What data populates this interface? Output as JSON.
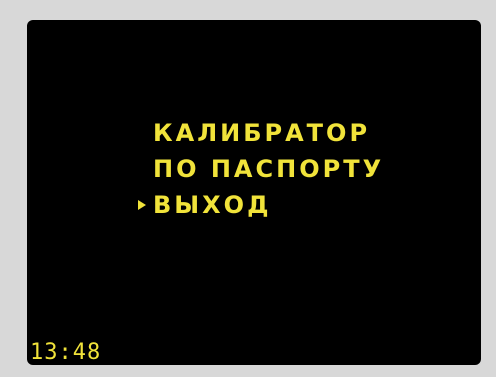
{
  "colors": {
    "text": "#f1e33a",
    "screen_background": "#000000",
    "bezel": "#d8d8d8"
  },
  "menu": {
    "items": [
      {
        "label": "КАЛИБРАТОР",
        "selected": false
      },
      {
        "label": "ПО ПАСПОРТУ",
        "selected": false
      },
      {
        "label": "ВЫХОД",
        "selected": true
      }
    ],
    "cursor_icon": "triangle-right-icon"
  },
  "status": {
    "time": "13:48"
  }
}
